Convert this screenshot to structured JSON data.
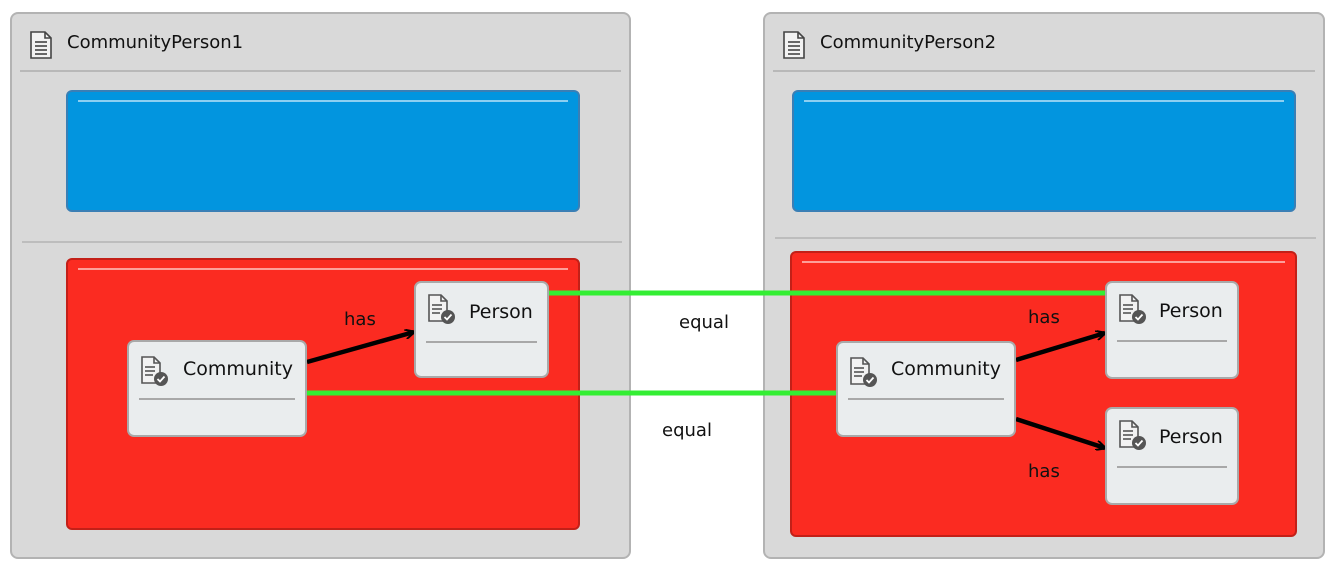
{
  "containers": [
    {
      "title": "CommunityPerson1"
    },
    {
      "title": "CommunityPerson2"
    }
  ],
  "nodes": {
    "c1_community": "Community",
    "c1_person": "Person",
    "c2_community": "Community",
    "c2_person_top": "Person",
    "c2_person_bottom": "Person"
  },
  "edges": {
    "c1_has": "has",
    "c2_has_top": "has",
    "c2_has_bottom": "has",
    "equal_person": "equal",
    "equal_community": "equal"
  },
  "colors": {
    "container_bg": "#d9d9d9",
    "blue_section": "#0295df",
    "red_section": "#fb2b21",
    "node_bg": "#eaedee",
    "equal_edge": "#33ee33",
    "has_edge": "#000000"
  }
}
